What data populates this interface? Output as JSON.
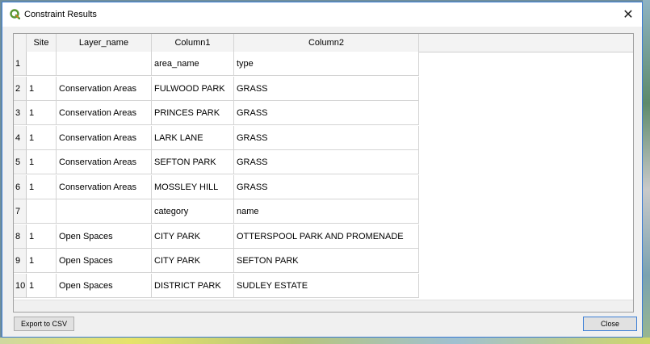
{
  "window": {
    "title": "Constraint Results",
    "close_glyph": "✕",
    "icon": "qgis-icon"
  },
  "table": {
    "headers": [
      "Site",
      "Layer_name",
      "Column1",
      "Column2"
    ],
    "rows": [
      {
        "num": "1",
        "site": "",
        "layer": "",
        "col1": "area_name",
        "col2": "type"
      },
      {
        "num": "2",
        "site": "1",
        "layer": "Conservation Areas",
        "col1": "FULWOOD PARK",
        "col2": "GRASS"
      },
      {
        "num": "3",
        "site": "1",
        "layer": "Conservation Areas",
        "col1": "PRINCES PARK",
        "col2": "GRASS"
      },
      {
        "num": "4",
        "site": "1",
        "layer": "Conservation Areas",
        "col1": "LARK LANE",
        "col2": "GRASS"
      },
      {
        "num": "5",
        "site": "1",
        "layer": "Conservation Areas",
        "col1": "SEFTON PARK",
        "col2": "GRASS"
      },
      {
        "num": "6",
        "site": "1",
        "layer": "Conservation Areas",
        "col1": "MOSSLEY HILL",
        "col2": "GRASS"
      },
      {
        "num": "7",
        "site": "",
        "layer": "",
        "col1": "category",
        "col2": "name"
      },
      {
        "num": "8",
        "site": "1",
        "layer": "Open Spaces",
        "col1": "CITY PARK",
        "col2": "OTTERSPOOL PARK AND PROMENADE"
      },
      {
        "num": "9",
        "site": "1",
        "layer": "Open Spaces",
        "col1": "CITY PARK",
        "col2": "SEFTON PARK"
      },
      {
        "num": "10",
        "site": "1",
        "layer": "Open Spaces",
        "col1": "DISTRICT PARK",
        "col2": "SUDLEY ESTATE"
      }
    ]
  },
  "buttons": {
    "export_label": "Export to CSV",
    "close_label": "Close"
  },
  "colors": {
    "accent": "#3a7bd5",
    "qgis_green": "#589632",
    "qgis_yellow": "#ee7913"
  }
}
